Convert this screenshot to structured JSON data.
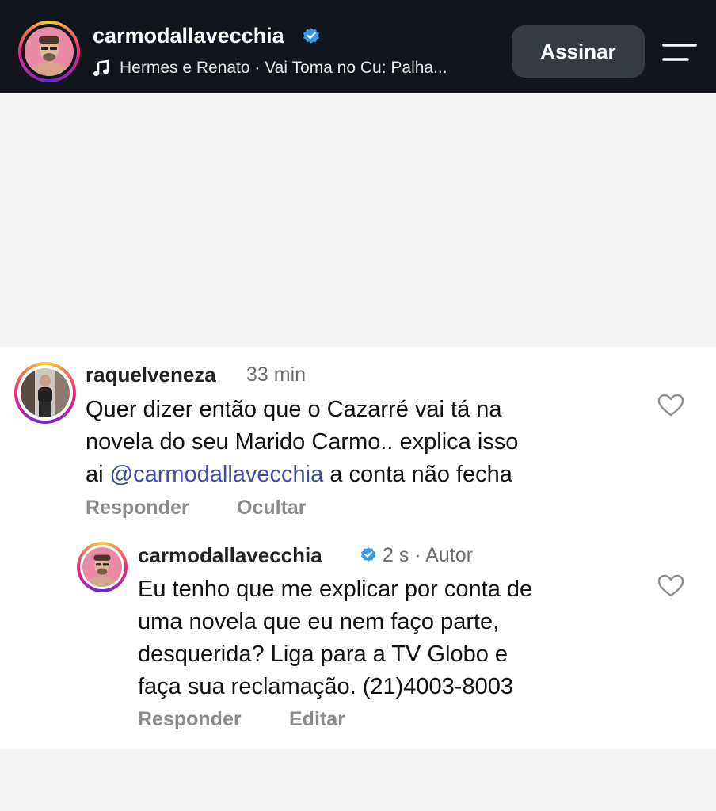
{
  "header": {
    "username": "carmodallavecchia",
    "music_text": "Hermes e Renato · Vai Toma no Cu: Palha...",
    "subscribe_label": "Assinar"
  },
  "comments": [
    {
      "username": "raquelveneza",
      "time": "33 min",
      "lines": [
        "Quer dizer então que o Cazarré vai tá na",
        "novela do seu Marido Carmo.. explica isso"
      ],
      "line3_prefix": "ai ",
      "mention": "@carmodallavecchia",
      "line3_suffix": " a conta não fecha",
      "actions": [
        "Responder",
        "Ocultar"
      ]
    },
    {
      "username": "carmodallavecchia",
      "time": "2 s · Autor",
      "lines": [
        "Eu tenho que me explicar por conta de",
        "uma novela que eu nem faço parte,",
        "desquerida? Liga para a TV Globo e",
        "faça sua reclamação. (21)4003-8003"
      ],
      "actions": [
        "Responder",
        "Editar"
      ]
    }
  ],
  "icons": {
    "verified": "verified-badge-icon",
    "music": "music-note-icon",
    "menu": "menu-icon",
    "like": "heart-icon"
  },
  "colors": {
    "header_bg": "#12151b",
    "verified_blue": "#3897f0",
    "mention": "#3d4ea5"
  }
}
